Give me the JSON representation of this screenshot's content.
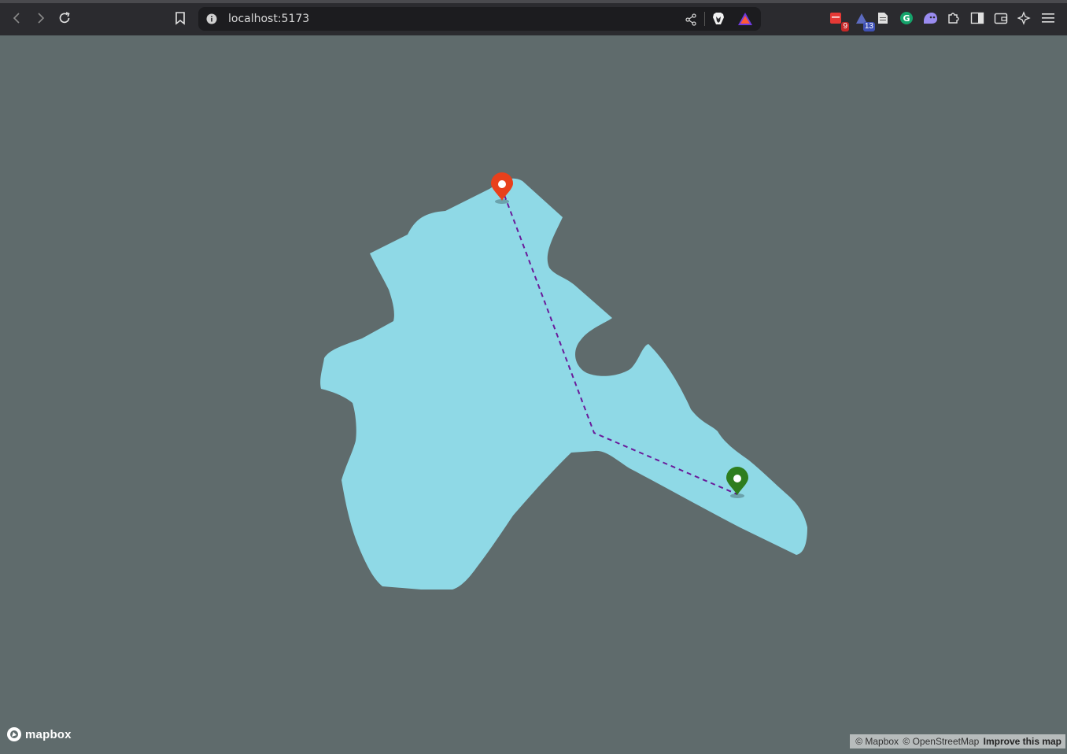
{
  "browser": {
    "url": "localhost:5173",
    "extensions": [
      {
        "name": "calendar-extension-icon",
        "badge": "9",
        "badge_color": "#c62828"
      },
      {
        "name": "todo-extension-icon",
        "badge": "13",
        "badge_color": "#3f51b5"
      },
      {
        "name": "doc-extension-icon"
      },
      {
        "name": "grammarly-icon"
      },
      {
        "name": "ghost-extension-icon"
      },
      {
        "name": "puzzle-icon"
      },
      {
        "name": "sidebar-icon"
      },
      {
        "name": "wallet-icon"
      },
      {
        "name": "sparkle-icon"
      },
      {
        "name": "menu-icon"
      }
    ]
  },
  "map": {
    "background_color": "#5f6b6c",
    "water_color": "#8fd9e6",
    "route_color": "#6a1b9a",
    "start_marker_color": "#e8401c",
    "end_marker_color": "#2e7d1e",
    "logo_text": "mapbox",
    "attribution": {
      "mapbox": "© Mapbox",
      "osm": "© OpenStreetMap",
      "improve": "Improve this map"
    }
  }
}
